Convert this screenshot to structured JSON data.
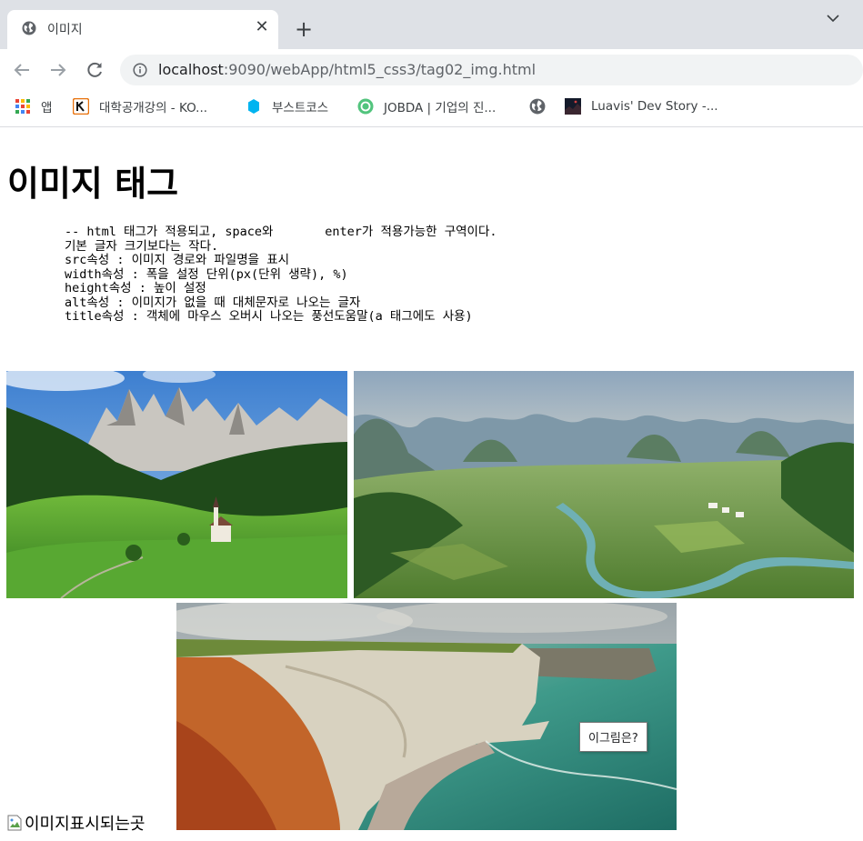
{
  "browser": {
    "tab": {
      "title": "이미지"
    },
    "address_bar": {
      "host": "localhost",
      "path": ":9090/webApp/html5_css3/tag02_img.html"
    },
    "bookmarks": [
      {
        "label": "앱",
        "icon": "apps-grid-icon"
      },
      {
        "label": "대학공개강의 - KO...",
        "icon": "kocw-logo-icon"
      },
      {
        "label": "부스트코스",
        "icon": "boostcourse-icon"
      },
      {
        "label": "JOBDA | 기업의 진...",
        "icon": "jobda-icon"
      },
      {
        "label": "",
        "icon": "globe-icon"
      },
      {
        "label": "Luavis' Dev Story -...",
        "icon": "luavis-thumb-icon"
      }
    ]
  },
  "page": {
    "heading": "이미지 태그",
    "pre_text": "-- html 태그가 적용되고, space와       enter가 적용가능한 구역이다.\n기본 글자 크기보다는 작다.\nsrc속성 : 이미지 경로와 파일명을 표시\nwidth속성 : 폭을 설정 단위(px(단위 생략), %)\nheight속성 : 높이 설정\nalt속성 : 이미지가 없을 때 대체문자로 나오는 글자\ntitle속성 : 객체에 마우스 오버시 나오는 풍선도움말(a 태그에도 사용)",
    "images": [
      {
        "name": "dolomites-church-photo"
      },
      {
        "name": "guilin-river-valley-photo"
      },
      {
        "name": "etretat-cliff-photo"
      }
    ],
    "broken_image_alt": "이미지표시되는곳",
    "tooltip": "이그림은?"
  },
  "colors": {
    "tabstrip_bg": "#dee1e6",
    "omnibox_bg": "#f1f3f4",
    "icon_gray": "#5f6368"
  }
}
